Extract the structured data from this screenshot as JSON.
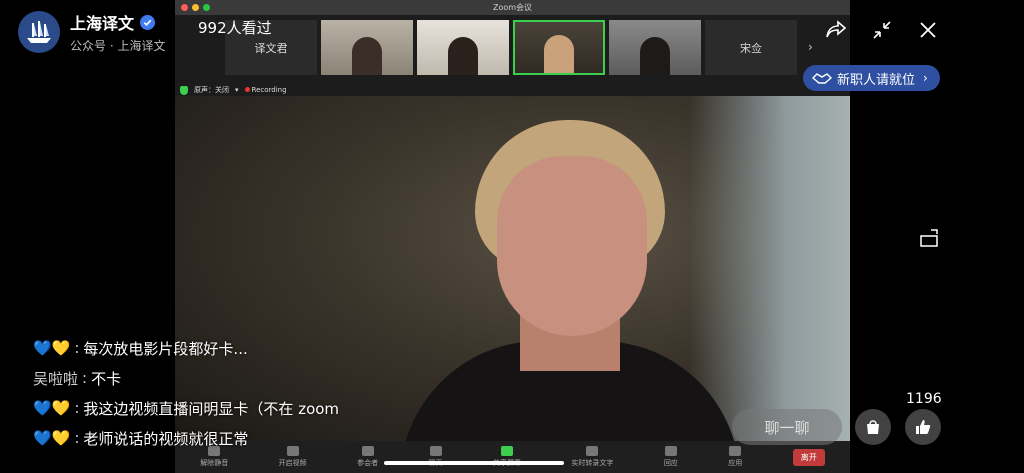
{
  "channel": {
    "name": "上海译文",
    "subtitle": "公众号 · 上海译文"
  },
  "viewers": "992人看过",
  "recruit_banner": "新职人请就位",
  "zoom": {
    "window_title": "Zoom会议",
    "participants": [
      {
        "name": "译文君",
        "type": "name"
      },
      {
        "name": "",
        "type": "video"
      },
      {
        "name": "",
        "type": "video"
      },
      {
        "name": "",
        "type": "video-active"
      },
      {
        "name": "",
        "type": "video"
      },
      {
        "name": "宋佥",
        "type": "name"
      }
    ],
    "audio_status": "原声：关闭",
    "recording_label": "Recording",
    "toolbar": [
      {
        "label": "解除静音"
      },
      {
        "label": "开启视频"
      },
      {
        "label": "参会者",
        "badge": "10"
      },
      {
        "label": "聊天",
        "badge": "1"
      },
      {
        "label": "共享屏幕"
      },
      {
        "label": "实时转录文字"
      },
      {
        "label": "回应"
      },
      {
        "label": "应用"
      }
    ],
    "leave_label": "离开"
  },
  "chat": [
    {
      "user": "💙💛",
      "emoji": true,
      "text": "每次放电影片段都好卡..."
    },
    {
      "user": "吴啦啦",
      "emoji": false,
      "text": "不卡"
    },
    {
      "user": "💙💛",
      "emoji": true,
      "text": "我这边视频直播间明显卡（不在 zoom"
    },
    {
      "user": "💙💛",
      "emoji": true,
      "text": "老师说话的视频就很正常"
    }
  ],
  "controls": {
    "chat_placeholder": "聊一聊",
    "like_count": "1196"
  },
  "colors": {
    "accent_blue": "#2f4fa0",
    "zoom_green": "#3ccf4e",
    "leave_red": "#c23b3b"
  }
}
